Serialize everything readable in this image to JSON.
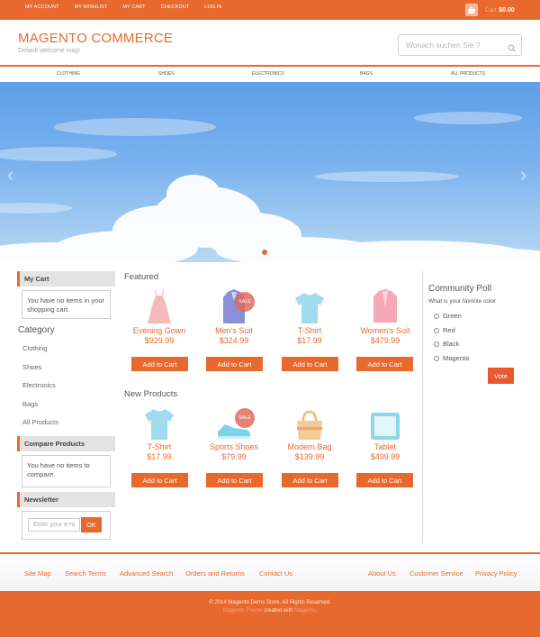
{
  "top_links": [
    "MY ACCOUNT",
    "MY WISHLIST",
    "MY CART",
    "CHECKOUT",
    "LOG IN"
  ],
  "header_cart": {
    "label": "Cart",
    "amount": "$0.00",
    "icon": "basket-icon"
  },
  "brand": {
    "name": "MAGENTO COMMERCE",
    "welcome": "Default welcome msg!"
  },
  "search": {
    "placeholder": "Wonach suchen Sie ?",
    "icon": "search-icon"
  },
  "nav": [
    "CLOTHING",
    "SHOES",
    "ELECTRONICS",
    "BAGS",
    "ALL PRODUCTS"
  ],
  "slider": {
    "prev_icon": "chevron-left-icon",
    "next_icon": "chevron-right-icon",
    "slides": 2,
    "active": 1
  },
  "sidebar": {
    "my_cart": {
      "title": "My Cart",
      "text": "You have no items in your shopping cart."
    },
    "category": {
      "title": "Category",
      "items": [
        "Clothing",
        "Shoes",
        "Electronics",
        "Bags",
        "All Products"
      ]
    },
    "compare": {
      "title": "Compare Products",
      "text": "You have no items to compare."
    },
    "newsletter": {
      "title": "Newsletter",
      "placeholder": "Enter your e-mail",
      "button": "OK"
    }
  },
  "featured": {
    "title": "Featured",
    "products": [
      {
        "name": "Evening Gown",
        "price": "$929.99",
        "icon": "dress-icon",
        "sale": false,
        "button": "Add to Cart"
      },
      {
        "name": "Men's Suit",
        "price": "$324.99",
        "icon": "suit-icon",
        "sale": true,
        "button": "Add to Cart"
      },
      {
        "name": "T-Shirt",
        "price": "$17.99",
        "icon": "tshirt-icon",
        "sale": false,
        "button": "Add to Cart"
      },
      {
        "name": "Women's Suit",
        "price": "$479.99",
        "icon": "jacket-icon",
        "sale": false,
        "button": "Add to Cart"
      }
    ]
  },
  "new_products": {
    "title": "New Products",
    "products": [
      {
        "name": "T-Shirt",
        "price": "$17.99",
        "icon": "tshirt-icon",
        "sale": false,
        "button": "Add to Cart"
      },
      {
        "name": "Sports Shoes",
        "price": "$79.99",
        "icon": "sneaker-icon",
        "sale": true,
        "button": "Add to Cart"
      },
      {
        "name": "Modern Bag",
        "price": "$139.99",
        "icon": "bag-icon",
        "sale": false,
        "button": "Add to Cart"
      },
      {
        "name": "Tablet",
        "price": "$499.99",
        "icon": "tablet-icon",
        "sale": false,
        "button": "Add to Cart"
      }
    ]
  },
  "sale_badge": "SALE",
  "poll": {
    "title": "Community Poll",
    "question": "What is your favorite color",
    "options": [
      "Green",
      "Red",
      "Black",
      "Magenta"
    ],
    "button": "Vote"
  },
  "footer": {
    "left_links": [
      "Site Map",
      "Search Terms",
      "Advanced Search",
      "Orders and Returns",
      "Contact Us"
    ],
    "right_links": [
      "About Us",
      "Customer Service",
      "Privacy Policy"
    ],
    "copyright": "© 2014 Magento Demo Store. All Rights Reserved.",
    "credit_prefix": "Magento Theme",
    "credit_mid": " created with ",
    "credit_suffix": "Magento",
    "credit_end": "."
  },
  "colors": {
    "accent": "#e8692e",
    "sale": "#e06a5c",
    "sky": "#6fa8ea"
  }
}
